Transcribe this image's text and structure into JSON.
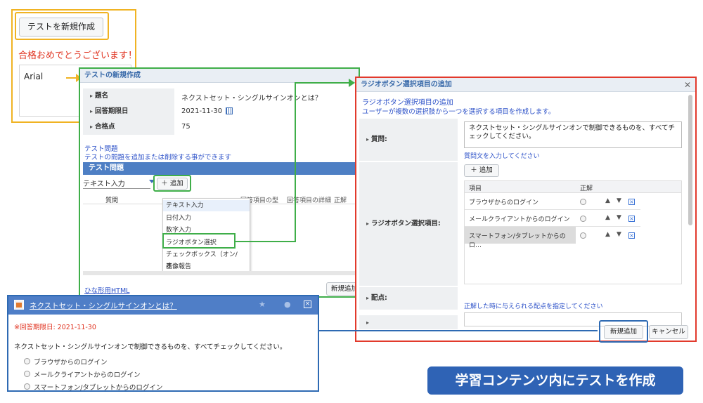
{
  "top_widget": {
    "create_button": "テストを新規作成",
    "congrats": "合格おめでとうございます！",
    "font_name": "Arial"
  },
  "new_test_dialog": {
    "title": "テストの新規作成",
    "fields": [
      {
        "label": "題名",
        "value": "ネクストセット・シングルサインオンとは？"
      },
      {
        "label": "回答期限日",
        "value": "2021-11-30"
      },
      {
        "label": "合格点",
        "value": "75"
      }
    ],
    "section_title": "テスト問題",
    "section_desc": "テストの問題を追加または削除する事ができます",
    "table_header": "テスト問題",
    "type_select": "テキスト入力",
    "add_button": "＋ 追加",
    "columns": [
      "質問",
      "回答項目の型",
      "回答項目の詳細",
      "正解"
    ],
    "dropdown_items": [
      "テキスト入力",
      "日付入力",
      "数字入力",
      "ラジオボタン選択",
      "チェックボックス（オン/オ...",
      "画像報告"
    ],
    "template_link": "ひな形用HTML",
    "bottom_button": "新規追加"
  },
  "radio_dialog": {
    "title": "ラジオボタン選択項目の追加",
    "heading": "ラジオボタン選択項目の追加",
    "desc": "ユーザーが複数の選択肢から一つを選択する項目を作成します。",
    "question_label": "質問:",
    "question_text": "ネクストセット・シングルサインオンで制御できるものを、すべてチェックしてください。",
    "question_hint": "質問文を入力してください",
    "add_button": "＋ 追加",
    "items_label": "ラジオボタン選択項目:",
    "col_item": "項目",
    "col_correct": "正解",
    "items": [
      "ブラウザからのログイン",
      "メールクライアントからのログイン",
      "スマートフォン/タブレットからのロ…"
    ],
    "points_label": "配点:",
    "points_hint": "正解した時に与えられる配点を指定してください",
    "submit_button": "新規追加",
    "cancel_button": "キャンセル"
  },
  "preview": {
    "title": "ネクストセット・シングルサインオンとは？",
    "deadline": "※回答期限日: 2021-11-30",
    "question": "ネクストセット・シングルサインオンで制御できるものを、すべてチェックしてください。",
    "options": [
      "ブラウザからのログイン",
      "メールクライアントからのログイン",
      "スマートフォン/タブレットからのログイン"
    ]
  },
  "caption": "学習コンテンツ内にテストを作成",
  "colors": {
    "orange": "#f0b323",
    "green": "#3fae49",
    "red": "#e23a2c",
    "blue": "#2e6ab3",
    "caption_bg": "#2f63b5"
  }
}
